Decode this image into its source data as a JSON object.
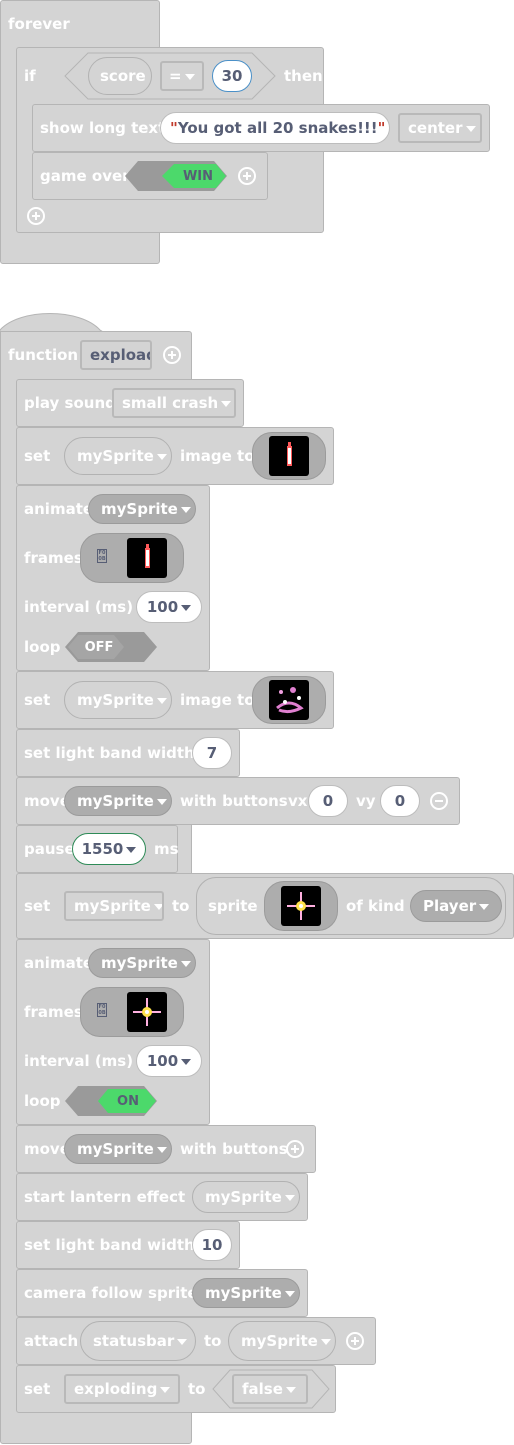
{
  "forever_script": {
    "hat_label": "forever",
    "if_label": "if",
    "score_var": "score",
    "operator": "=",
    "compare_value": "30",
    "then_label": "then",
    "show_long_text_label": "show long text",
    "long_text": "You got all 20 snakes!!!",
    "text_position": "center",
    "game_over_label": "game over",
    "win_toggle": "WIN"
  },
  "function_script": {
    "function_label": "function",
    "function_name": "expload",
    "play_sound_label": "play sound",
    "sound_name": "small crash",
    "set_label": "set",
    "sprite_var": "mySprite",
    "image_to_label": "image to",
    "animate_label": "animate",
    "frames_label": "frames",
    "interval_label": "interval (ms)",
    "loop_label": "loop",
    "interval_1": "100",
    "loop_1": "OFF",
    "set_light_band_label": "set light band width",
    "light_band_1": "7",
    "move_label": "move",
    "with_buttons_label": "with buttons",
    "vx_label": "vx",
    "vy_label": "vy",
    "vx_value": "0",
    "vy_value": "0",
    "pause_label": "pause",
    "pause_value": "1550",
    "ms_label": "ms",
    "to_label": "to",
    "sprite_label": "sprite",
    "of_kind_label": "of kind",
    "kind_value": "Player",
    "interval_2": "100",
    "loop_2": "ON",
    "start_lantern_label": "start lantern effect",
    "light_band_2": "10",
    "camera_follow_label": "camera follow sprite",
    "attach_label": "attach",
    "statusbar_var": "statusbar",
    "exploding_var": "exploding",
    "bool_value": "false",
    "frames_glyph": "F0 0B"
  },
  "colors": {
    "block": "#d4d4d4",
    "dark_slot": "#adadad",
    "toggle_on": "#4cd96b",
    "value_text": "#575e75"
  }
}
